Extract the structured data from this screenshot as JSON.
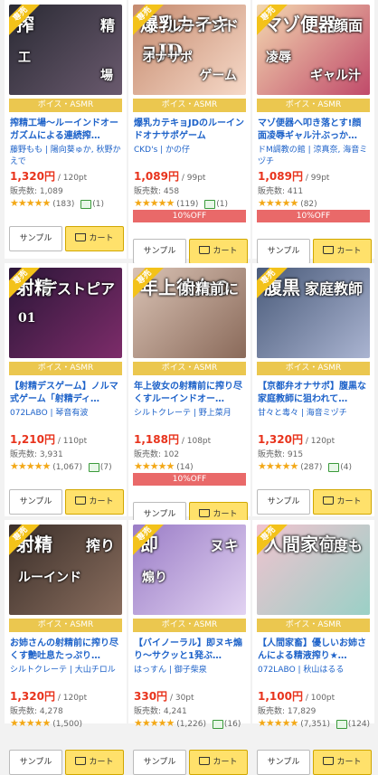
{
  "common": {
    "category": "ボイス・ASMR",
    "exclusive": "専売",
    "sample_label": "サンプル",
    "cart_label": "カート",
    "sales_prefix": "販売数: "
  },
  "products": [
    {
      "title": "搾精工場～ルーインドオーガズムによる連続搾…",
      "maker": "藤野もも | 陽向葵ゅか, 秋野かえで",
      "price": "1,320円",
      "points": "120pt",
      "sales": "1,089",
      "stars": "★★★★★",
      "reviews": "(183)",
      "comments": "(1)",
      "discount": "",
      "thumb_text": [
        "搾",
        "精",
        "工",
        "場"
      ],
      "colors": [
        "#2a2a34",
        "#6a5a6e"
      ]
    },
    {
      "title": "爆乳カテキョJDのルーインドオナサポゲーム",
      "maker": "CKD's | かの仔",
      "price": "1,089円",
      "points": "99pt",
      "sales": "458",
      "stars": "★★★★★",
      "reviews": "(119)",
      "comments": "(1)",
      "discount": "10%OFF",
      "thumb_text": [
        "爆乳カテキョJD",
        "ルーインド",
        "オナサポ",
        "ゲーム"
      ],
      "colors": [
        "#c58a6e",
        "#f6d9c8"
      ]
    },
    {
      "title": "マゾ便器へ叩き落とす!顔面凌辱ギャル汁ぶっか…",
      "maker": "ドM調教の館 | 涼真奈, 海音ミヅチ",
      "price": "1,089円",
      "points": "99pt",
      "sales": "411",
      "stars": "★★★★★",
      "reviews": "(82)",
      "comments": "",
      "discount": "10%OFF",
      "thumb_text": [
        "マゾ便器",
        "顔面",
        "凌辱",
        "ギャル汁"
      ],
      "colors": [
        "#f3d8b0",
        "#c04a6a"
      ]
    },
    {
      "title": "【射精デスゲーム】ノルマ式ゲーム「射精ディ…",
      "maker": "072LABO | 琴音有波",
      "price": "1,210円",
      "points": "110pt",
      "sales": "3,931",
      "stars": "★★★★★",
      "reviews": "(1,067)",
      "comments": "(7)",
      "discount": "",
      "thumb_text": [
        "射精",
        "デストピア",
        "01",
        ""
      ],
      "colors": [
        "#2b1638",
        "#7d2c6a"
      ]
    },
    {
      "title": "年上彼女の射精前に搾り尽くすルーインドオー…",
      "maker": "シルトクレーテ | 野上菜月",
      "price": "1,188円",
      "points": "108pt",
      "sales": "102",
      "stars": "★★★★★",
      "reviews": "(14)",
      "comments": "",
      "discount": "10%OFF",
      "thumb_text": [
        "年上彼女の",
        "射精前に",
        "",
        ""
      ],
      "colors": [
        "#d9c2b4",
        "#8a6a5a"
      ]
    },
    {
      "title": "【京都弁オナサポ】腹黒な家庭教師に狙われて…",
      "maker": "甘々と毒々 | 海音ミヅチ",
      "price": "1,320円",
      "points": "120pt",
      "sales": "915",
      "stars": "★★★★★",
      "reviews": "(287)",
      "comments": "(4)",
      "discount": "",
      "thumb_text": [
        "腹黒",
        "家庭教師",
        "",
        ""
      ],
      "colors": [
        "#4a5b7a",
        "#aab4d1"
      ]
    },
    {
      "title": "お姉さんの射精前に搾り尽くす艶吐息たっぷり…",
      "maker": "シルトクレーテ | 大山チロル",
      "price": "1,320円",
      "points": "120pt",
      "sales": "4,278",
      "stars": "★★★★★",
      "reviews": "(1,500)",
      "comments": "",
      "discount": "",
      "thumb_text": [
        "射精",
        "搾り",
        "ルーインド",
        ""
      ],
      "colors": [
        "#3b2f2a",
        "#8a6e5e"
      ]
    },
    {
      "title": "【バイノーラル】即ヌキ煽り～サクッと1発ぶ…",
      "maker": "はっすん | 御子柴泉",
      "price": "330円",
      "points": "30pt",
      "sales": "4,241",
      "stars": "★★★★★",
      "reviews": "(1,226)",
      "comments": "(16)",
      "discount": "",
      "thumb_text": [
        "即",
        "ヌキ",
        "煽り",
        ""
      ],
      "colors": [
        "#9a7cc6",
        "#e2d3f2"
      ]
    },
    {
      "title": "【人間家畜】優しいお姉さんによる精液搾り★…",
      "maker": "072LABO | 秋山はるる",
      "price": "1,100円",
      "points": "100pt",
      "sales": "17,829",
      "stars": "★★★★★",
      "reviews": "(7,351)",
      "comments": "(124)",
      "discount": "",
      "thumb_text": [
        "人間家畜",
        "何度も",
        "",
        ""
      ],
      "colors": [
        "#f0c3cf",
        "#9ad0c6"
      ]
    }
  ]
}
